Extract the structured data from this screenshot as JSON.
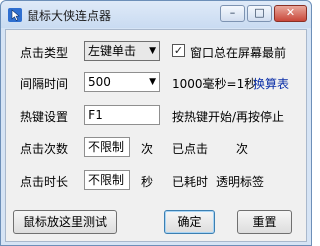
{
  "window": {
    "title": "鼠标大侠连点器",
    "icon": "mouse-app-icon",
    "minimize_glyph": "–",
    "maximize_glyph": "□",
    "close_glyph": "✕"
  },
  "click_type": {
    "label": "点击类型",
    "value": "左键单击"
  },
  "always_on_top": {
    "label": "窗口总在屏幕最前",
    "checked": true
  },
  "interval": {
    "label": "间隔时间",
    "value": "500",
    "note": "1000毫秒=1秒",
    "link": "换算表"
  },
  "hotkey": {
    "label": "热键设置",
    "value": "F1",
    "note": "按热键开始/再按停止"
  },
  "click_count": {
    "label": "点击次数",
    "value": "不限制",
    "unit": "次",
    "status_label": "已点击",
    "status_unit": "次"
  },
  "click_duration": {
    "label": "点击时长",
    "value": "不限制",
    "unit": "秒",
    "status_label": "已耗时",
    "opacity_label": "透明标签"
  },
  "buttons": {
    "test": "鼠标放这里测试",
    "ok": "确定",
    "reset": "重置"
  }
}
